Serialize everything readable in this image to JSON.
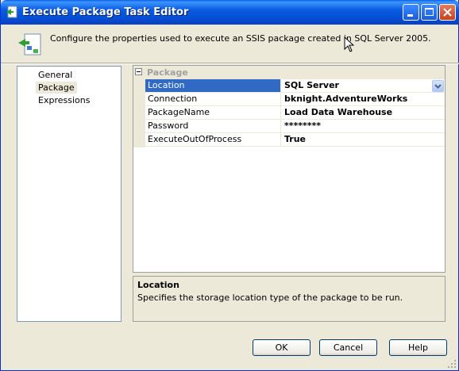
{
  "window": {
    "title": "Execute Package Task Editor"
  },
  "header": {
    "description": "Configure the properties used to execute an SSIS package created in SQL Server 2005."
  },
  "nav": {
    "items": [
      "General",
      "Package",
      "Expressions"
    ],
    "selected": "Package"
  },
  "grid": {
    "category": "Package",
    "rows": [
      {
        "name": "Location",
        "value": "SQL Server"
      },
      {
        "name": "Connection",
        "value": "bknight.AdventureWorks"
      },
      {
        "name": "PackageName",
        "value": "Load Data Warehouse"
      },
      {
        "name": "Password",
        "value": "********"
      },
      {
        "name": "ExecuteOutOfProcess",
        "value": "True"
      }
    ],
    "selected_row": "Location"
  },
  "help": {
    "title": "Location",
    "text": "Specifies the storage location type of the package to be run."
  },
  "buttons": {
    "ok": "OK",
    "cancel": "Cancel",
    "help": "Help"
  },
  "colors": {
    "titlebar": "#0A5CE0",
    "selection": "#316AC5",
    "face": "#ECE9D8"
  }
}
